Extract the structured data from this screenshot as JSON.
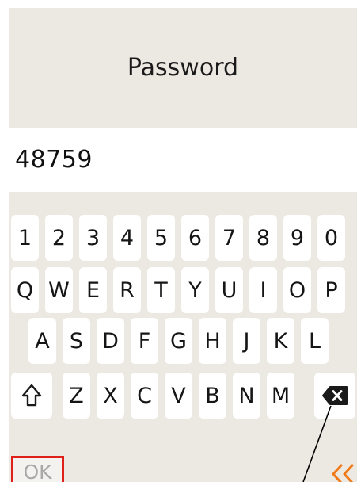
{
  "header": {
    "title": "Password"
  },
  "password_field": {
    "value": "48759"
  },
  "keyboard": {
    "row_numbers": [
      "1",
      "2",
      "3",
      "4",
      "5",
      "6",
      "7",
      "8",
      "9",
      "0"
    ],
    "row_q": [
      "Q",
      "W",
      "E",
      "R",
      "T",
      "Y",
      "U",
      "I",
      "O",
      "P"
    ],
    "row_a": [
      "A",
      "S",
      "D",
      "F",
      "G",
      "H",
      "J",
      "K",
      "L"
    ],
    "row_z": [
      "Z",
      "X",
      "C",
      "V",
      "B",
      "N",
      "M"
    ],
    "shift_icon": "shift-up-arrow",
    "backspace_icon": "backspace-x"
  },
  "footer": {
    "ok_label": "OK",
    "back_icon": "double-chevron-left",
    "back_color": "#f07a1a"
  },
  "colors": {
    "panel_background": "#ece9e2",
    "key_background": "#ffffff",
    "ok_border": "#e0201a"
  }
}
